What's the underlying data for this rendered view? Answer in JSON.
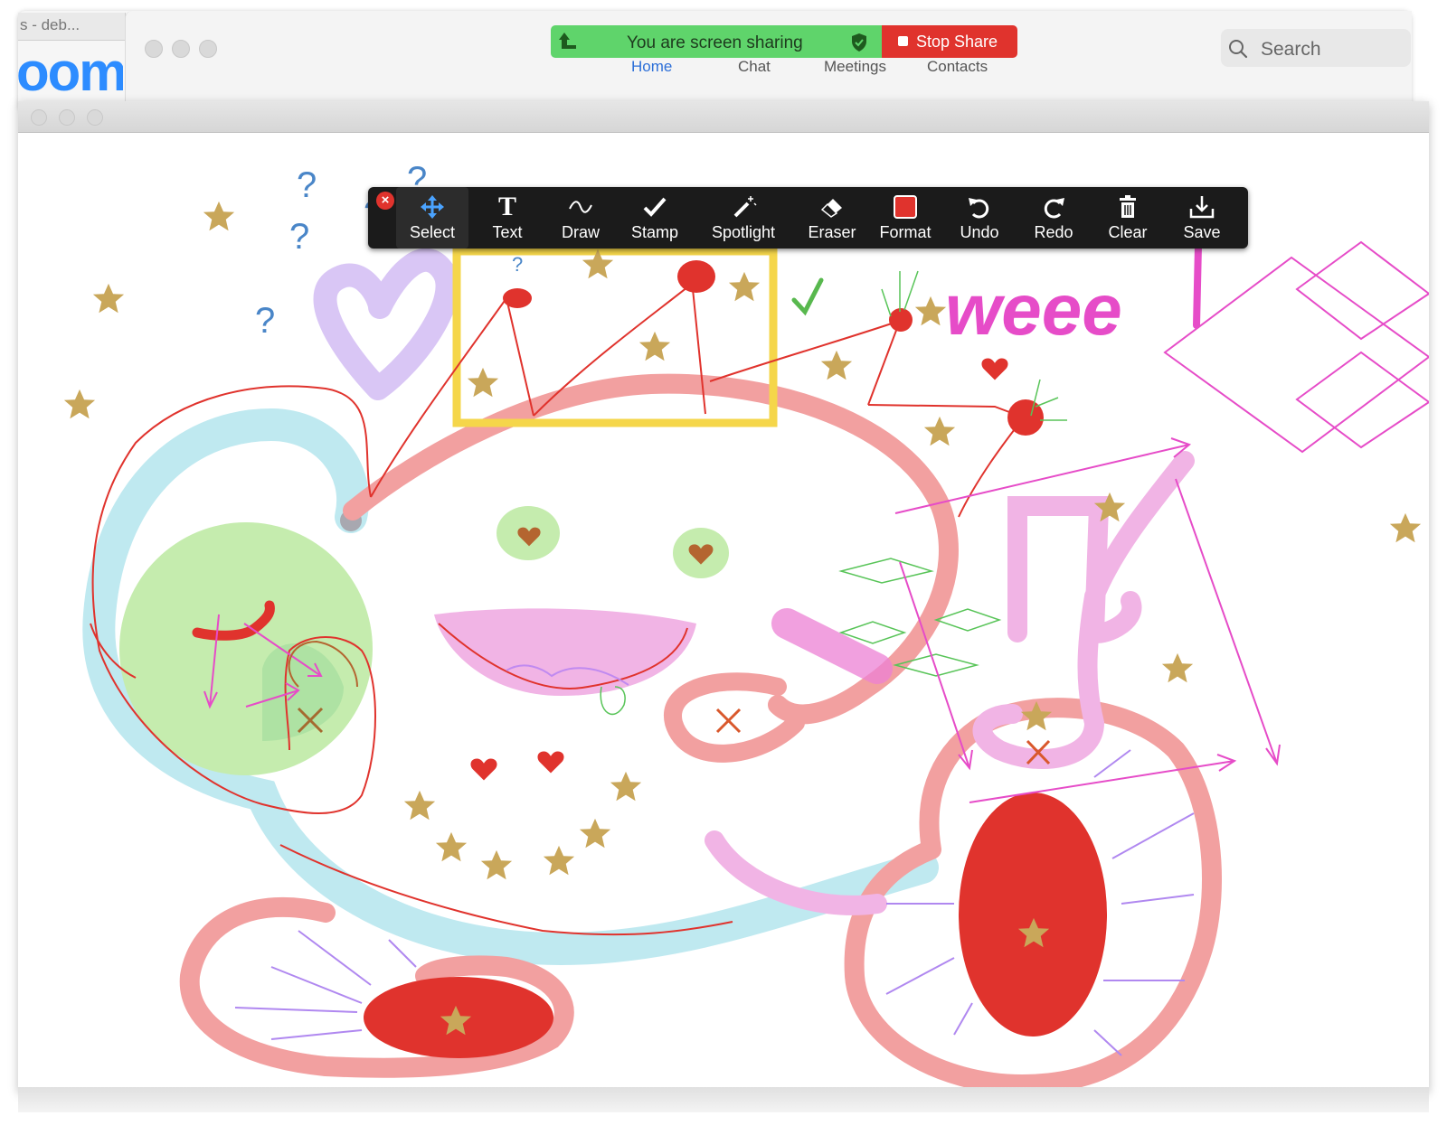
{
  "background_app": {
    "behind_tab_title": "s - deb...",
    "logo_text": "oom",
    "nav_tabs": [
      "Home",
      "Chat",
      "Meetings",
      "Contacts"
    ],
    "active_tab": "Home",
    "search_placeholder": "Search"
  },
  "share_banner": {
    "message": "You are screen sharing",
    "stop_label": "Stop Share",
    "color": "#5fd46b",
    "stop_color": "#e0332d"
  },
  "toolbar": {
    "tools": [
      {
        "label": "Select",
        "icon": "move-arrows-icon"
      },
      {
        "label": "Text",
        "icon": "text-t-icon"
      },
      {
        "label": "Draw",
        "icon": "squiggle-icon"
      },
      {
        "label": "Stamp",
        "icon": "checkmark-icon"
      },
      {
        "label": "Spotlight",
        "icon": "magic-wand-icon"
      },
      {
        "label": "Eraser",
        "icon": "eraser-icon"
      },
      {
        "label": "Format",
        "icon": "red-square-icon"
      },
      {
        "label": "Undo",
        "icon": "undo-icon"
      },
      {
        "label": "Redo",
        "icon": "redo-icon"
      },
      {
        "label": "Clear",
        "icon": "trash-icon"
      },
      {
        "label": "Save",
        "icon": "download-icon"
      }
    ],
    "active_tool": "Select",
    "format_color": "#e0332d"
  },
  "whiteboard": {
    "annotation_text": "weee",
    "stamp_color": "#c9a75a",
    "ink_colors": [
      "#e0332d",
      "#f2a0a0",
      "#bfe9f0",
      "#ee78c9",
      "#c5a8f0",
      "#a8e08a",
      "#f5d64a",
      "#4a86c8"
    ]
  }
}
